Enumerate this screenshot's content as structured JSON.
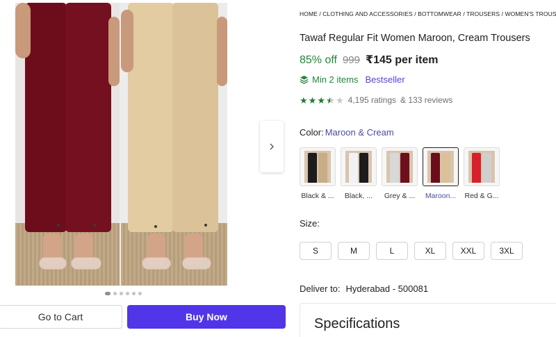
{
  "breadcrumb": [
    "HOME",
    "CLOTHING AND ACCESSORIES",
    "BOTTOMWEAR",
    "TROUSERS",
    "WOMEN'S TROUSERS"
  ],
  "product": {
    "title": "Tawaf Regular Fit Women Maroon, Cream Trousers",
    "discount": "85% off",
    "mrp": "999",
    "price": "₹145 per item",
    "min_items": "Min 2 items",
    "bestseller": "Bestseller",
    "rating_stars": 3.5,
    "ratings": "4,195 ratings",
    "reviews": "& 133 reviews"
  },
  "color": {
    "label": "Color:",
    "selected": "Maroon & Cream",
    "options": [
      {
        "name": "Black & ...",
        "colors": [
          "#1c1c1c",
          "#c9ad86"
        ]
      },
      {
        "name": "Black, ...",
        "colors": [
          "#f2f2f2",
          "#1c1c1c"
        ]
      },
      {
        "name": "Grey & ...",
        "colors": [
          "#d8d8d8",
          "#6e0f1c"
        ]
      },
      {
        "name": "Maroon...",
        "colors": [
          "#6b0e1c",
          "#d9c19a"
        ]
      },
      {
        "name": "Red & G...",
        "colors": [
          "#d8202a",
          "#cfcfcf"
        ]
      }
    ],
    "selected_index": 3
  },
  "size": {
    "label": "Size:",
    "options": [
      "S",
      "M",
      "L",
      "XL",
      "XXL",
      "3XL"
    ]
  },
  "delivery": {
    "label": "Deliver to:",
    "location": "Hyderabad - 500081"
  },
  "specifications": {
    "title": "Specifications"
  },
  "actions": {
    "cart": "Go to Cart",
    "buy": "Buy Now"
  },
  "gallery": {
    "dot_count": 6,
    "active_dot": 0
  },
  "icons": {
    "next": "chevron-right-icon",
    "stack": "stack-icon",
    "star": "star-icon"
  },
  "colors": {
    "accent": "#5135e8",
    "discount": "#22863a",
    "maroon": "#6b0e1c",
    "cream": "#e1c9a0"
  }
}
